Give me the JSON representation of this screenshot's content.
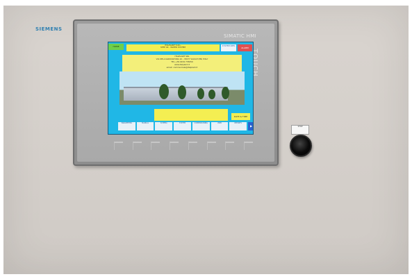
{
  "panel": {
    "brand": "SIEMENS",
    "model": "SIMATIC HMI",
    "touch": "TOUCH"
  },
  "screen": {
    "home_button": "HOME",
    "header_line1": "ITALPLANT S.R.L.",
    "header_line2": "STEP 40 - WATER SYSTEM",
    "top_button_1": "SYSTEM INFO",
    "alarm_button": "ALARM",
    "info_line1": "ITALPLANT SRL",
    "info_line2": "VIA DELL'AGRICOLTURA 10 - 33077 SACILE (PN) ITALY",
    "info_line3": "TEL +39 0434 735050",
    "info_line4": "www.italplant.it",
    "info_line5": "email: commerciale@italplant.it",
    "status_text": "",
    "date_button": "DATE & TIME",
    "nav_buttons": [
      "PARAMETERS",
      "MANUAL",
      "SCHEMA",
      "SYSTEM",
      "COMMISSIONING",
      "USER",
      "REPORTS"
    ],
    "last_button": "▶"
  },
  "estop_label": "STOP"
}
